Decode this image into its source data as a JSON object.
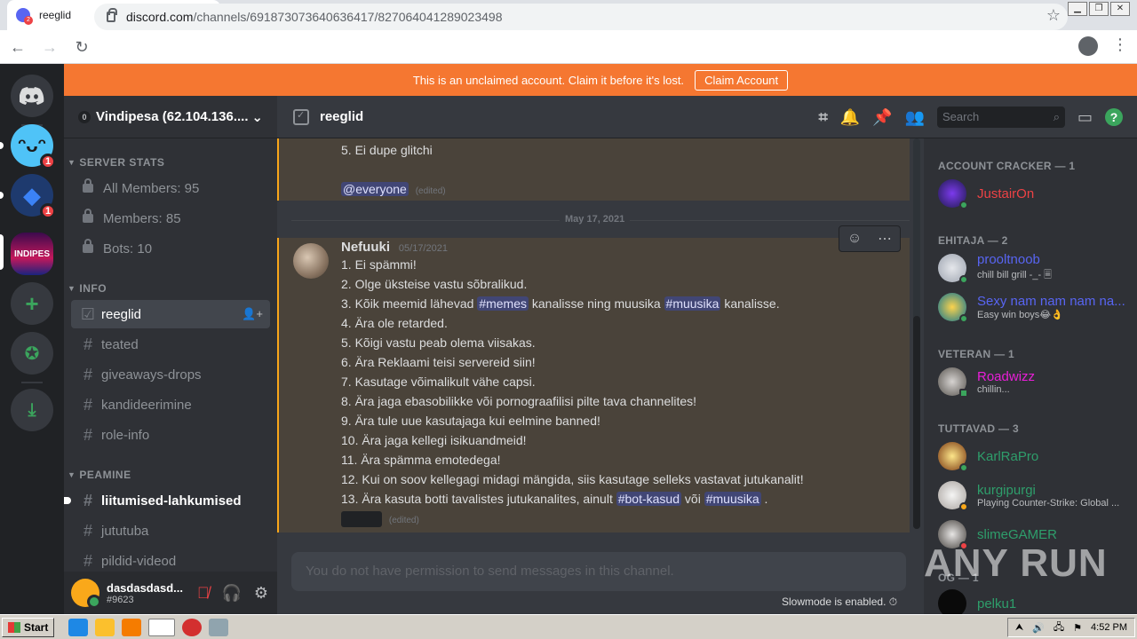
{
  "browser": {
    "tab_title": "reeglid",
    "url_host": "discord.com",
    "url_path": "/channels/691873073640636417/827064041289023498"
  },
  "banner": {
    "text": "This is an unclaimed account. Claim it before it's lost.",
    "button": "Claim Account"
  },
  "guilds": {
    "badge1": "1",
    "badge2": "1",
    "server3_label": "INDIPES"
  },
  "server": {
    "boost_count": "0",
    "name": "Vindipesa (62.104.136...."
  },
  "sidebar": {
    "cat_stats": "SERVER STATS",
    "stat_all": "All Members: 95",
    "stat_members": "Members: 85",
    "stat_bots": "Bots: 10",
    "cat_info": "INFO",
    "ch_reeglid": "reeglid",
    "ch_teated": "teated",
    "ch_giveaways": "giveaways-drops",
    "ch_kandideerimine": "kandideerimine",
    "ch_roleinfo": "role-info",
    "cat_peamine": "PEAMINE",
    "ch_liitumised": "liitumised-lahkumised",
    "ch_jututuba": "jututuba",
    "ch_pildid": "pildid-videod"
  },
  "user": {
    "name": "dasdasdasd...",
    "tag": "#9623"
  },
  "chat": {
    "channel_name": "reeglid",
    "search_placeholder": "Search",
    "prev_line": "5. Ei dupe glitchi",
    "prev_mention": "@everyone",
    "edited": "(edited)",
    "date_divider": "May 17, 2021",
    "author": "Nefuuki",
    "timestamp": "05/17/2021",
    "l1": "1. Ei spämmi!",
    "l2": "2. Olge üksteise vastu sõbralikud.",
    "l3a": "3. Kõik meemid lähevad",
    "l3m1": "#memes",
    "l3b": "kanalisse ning muusika",
    "l3m2": "#muusika",
    "l3c": "kanalisse.",
    "l4": "4. Ära ole retarded.",
    "l5": "5. Kõigi vastu peab olema viisakas.",
    "l6": "6. Ära Reklaami teisi servereid siin!",
    "l7": "7. Kasutage võimalikult vähe capsi.",
    "l8": "8. Ära jaga ebasobilikke või pornograafilisi pilte tava channelites!",
    "l9": "9. Ära tule uue kasutajaga kui eelmine banned!",
    "l10": "10. Ära jaga kellegi isikuandmeid!",
    "l11": "11. Ära spämma emotedega!",
    "l12": "12. Kui on soov kellegagi midagi mängida, siis kasutage selleks vastavat jutukanalit!",
    "l13a": "13. Ära kasuta botti tavalistes jutukanalites, ainult",
    "l13m1": "#bot-kasud",
    "l13b": "või",
    "l13m2": "#muusika",
    "l13c": ".",
    "composer_placeholder": "You do not have permission to send messages in this channel.",
    "slowmode": "Slowmode is enabled."
  },
  "members": {
    "role1": "ACCOUNT CRACKER — 1",
    "m1": "JustairOn",
    "role2": "EHITAJA — 2",
    "m2": "prooltnoob",
    "m2_act": "chill bill grill -_- 🗏",
    "m3": "Sexy nam nam nam na...",
    "m3_act": "Easy win boys😂👌",
    "role3": "VETERAN — 1",
    "m4": "Roadwizz",
    "m4_act": "chillin...",
    "role4": "TUTTAVAD — 3",
    "m5": "KarlRaPro",
    "m6": "kurgipurgi",
    "m6_act": "Playing Counter-Strike: Global ...",
    "m7": "slimeGAMER",
    "role5": "OG — 1",
    "m8": "pelku1"
  },
  "watermark": "ANY RUN",
  "taskbar": {
    "start": "Start",
    "time": "4:52 PM"
  },
  "colors": {
    "banner": "#f57731",
    "mention_highlight": "#4a433a",
    "role_red": "#ed4245",
    "role_blue": "#5865f2",
    "role_magenta": "#e91ed8",
    "role_green": "#2e9e6b"
  }
}
